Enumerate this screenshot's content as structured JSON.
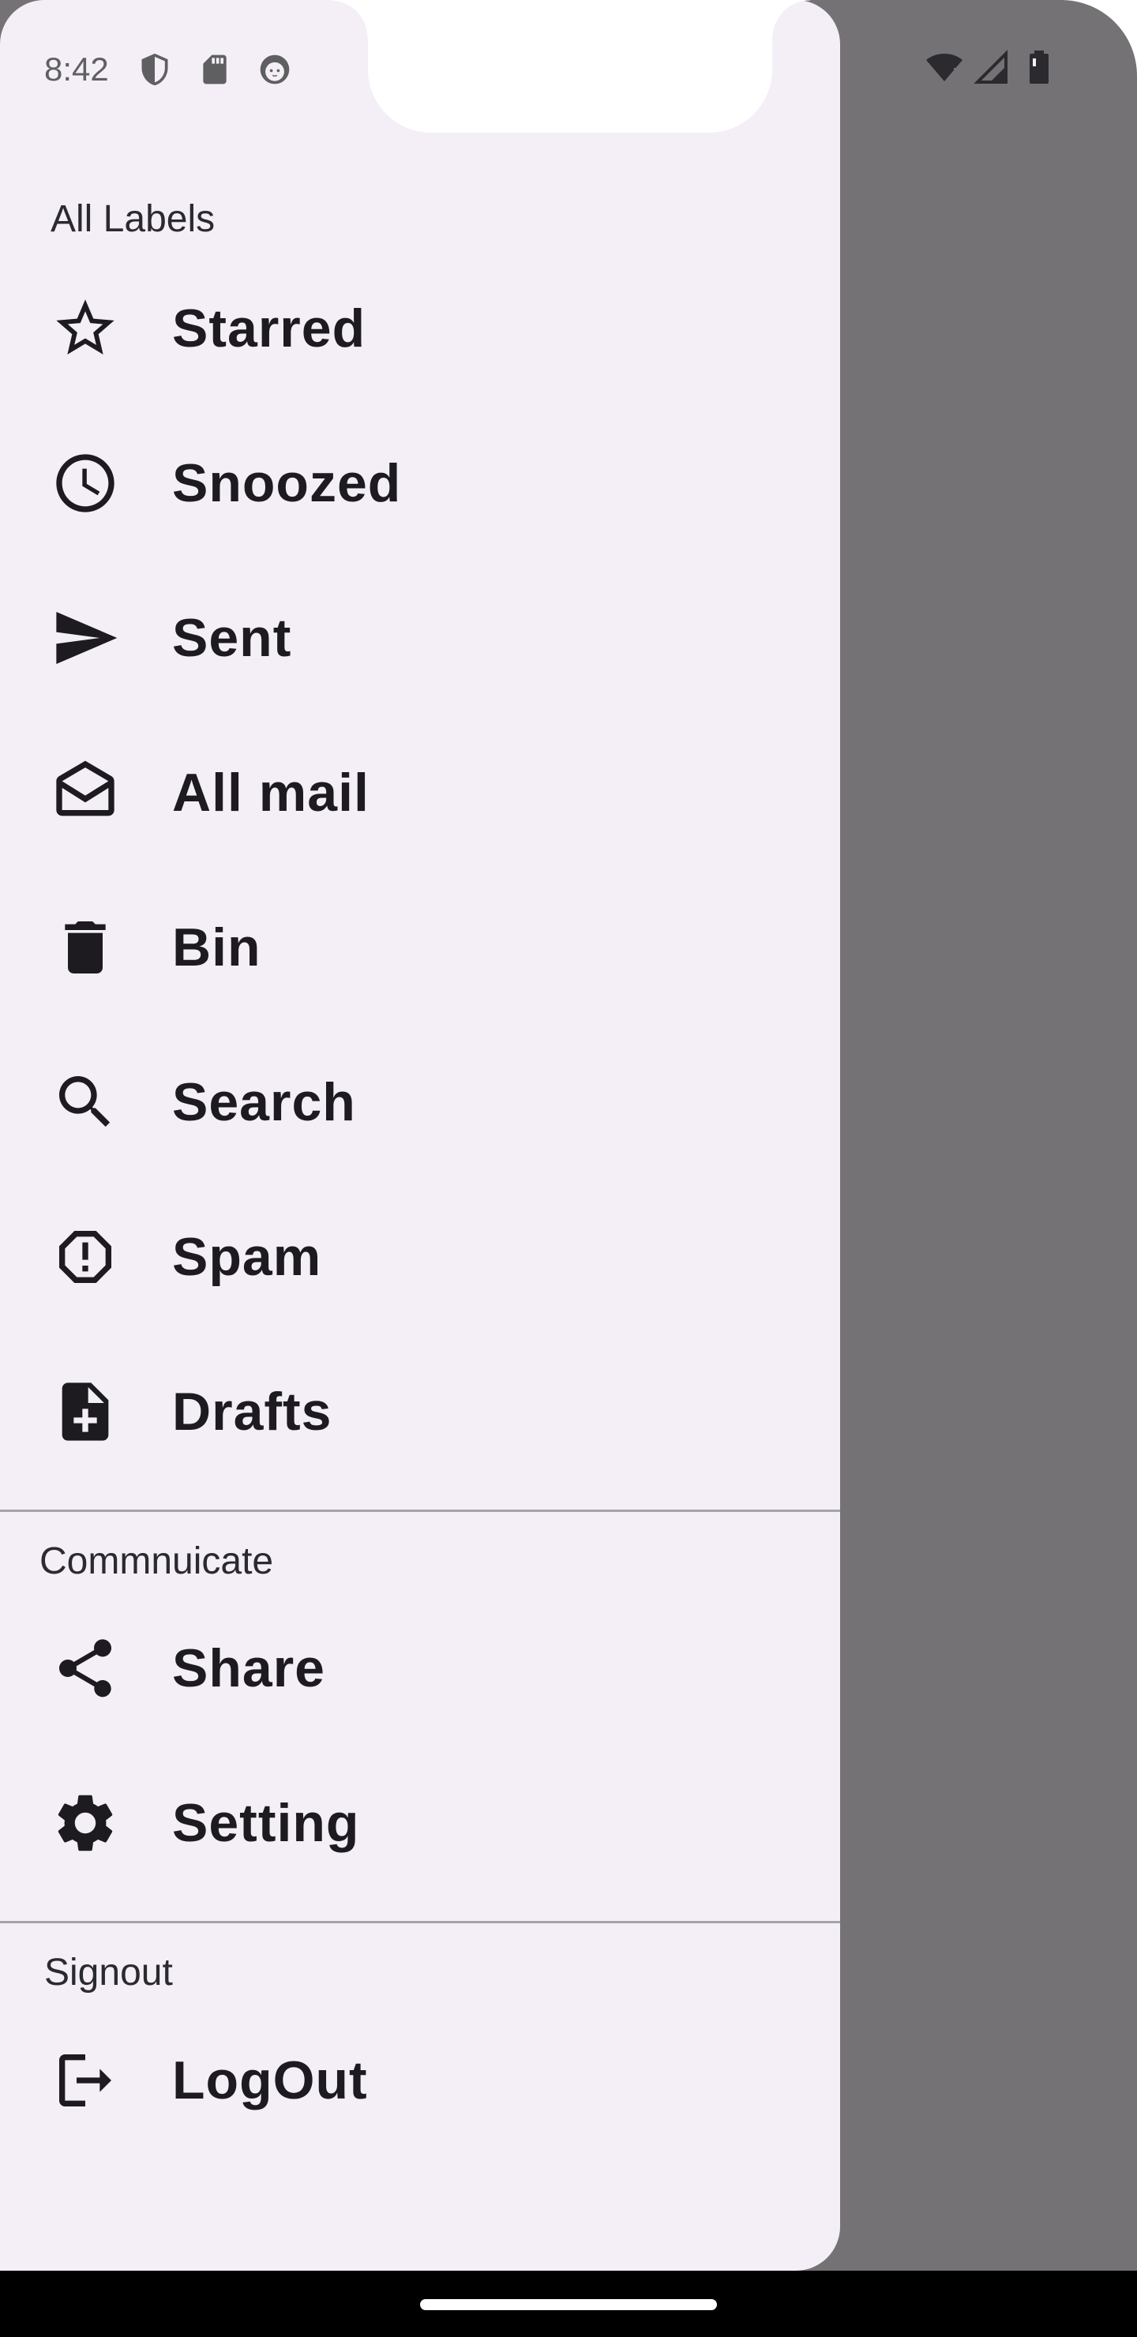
{
  "status_bar": {
    "time": "8:42",
    "left_icons": [
      "shield-icon",
      "sd-card-icon",
      "cat-face-icon"
    ],
    "right_icons": [
      "wifi-icon",
      "signal-icon",
      "battery-icon"
    ]
  },
  "drawer": {
    "sections": [
      {
        "title": "All Labels",
        "items": [
          {
            "label": "Starred",
            "icon": "star-outline-icon"
          },
          {
            "label": "Snoozed",
            "icon": "clock-icon"
          },
          {
            "label": "Sent",
            "icon": "send-icon"
          },
          {
            "label": "All mail",
            "icon": "mail-open-icon"
          },
          {
            "label": "Bin",
            "icon": "trash-icon"
          },
          {
            "label": "Search",
            "icon": "search-icon"
          },
          {
            "label": "Spam",
            "icon": "report-icon"
          },
          {
            "label": "Drafts",
            "icon": "note-add-icon"
          }
        ]
      },
      {
        "title": "Commnuicate",
        "items": [
          {
            "label": "Share",
            "icon": "share-icon"
          },
          {
            "label": "Setting",
            "icon": "gear-icon"
          }
        ]
      },
      {
        "title": "Signout",
        "items": [
          {
            "label": "LogOut",
            "icon": "logout-icon"
          }
        ]
      }
    ]
  },
  "colors": {
    "drawer_bg": "#f4eff7",
    "scrim": "#747275",
    "text": "#1d1b20",
    "divider": "#a7a3aa"
  }
}
